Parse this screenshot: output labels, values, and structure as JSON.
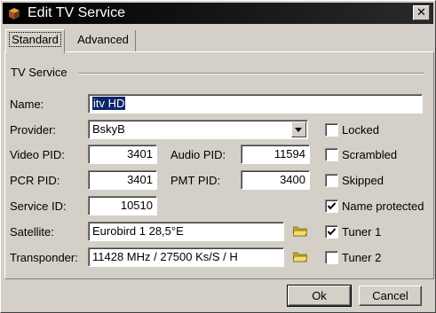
{
  "window": {
    "title": "Edit TV Service",
    "close_glyph": "✕"
  },
  "tabs": [
    {
      "label": "Standard",
      "active": true
    },
    {
      "label": "Advanced",
      "active": false
    }
  ],
  "group": {
    "title": "TV Service"
  },
  "fields": {
    "name": {
      "label": "Name:",
      "value": "itv HD"
    },
    "provider": {
      "label": "Provider:",
      "value": "BskyB"
    },
    "video_pid": {
      "label": "Video PID:",
      "value": "3401"
    },
    "audio_pid": {
      "label": "Audio PID:",
      "value": "11594"
    },
    "pcr_pid": {
      "label": "PCR PID:",
      "value": "3401"
    },
    "pmt_pid": {
      "label": "PMT PID:",
      "value": "3400"
    },
    "service_id": {
      "label": "Service ID:",
      "value": "10510"
    },
    "satellite": {
      "label": "Satellite:",
      "value": "Eurobird 1 28,5°E"
    },
    "transponder": {
      "label": "Transponder:",
      "value": "11428 MHz / 27500 Ks/S / H"
    }
  },
  "checkboxes": {
    "locked": {
      "label": "Locked",
      "checked": false
    },
    "scrambled": {
      "label": "Scrambled",
      "checked": false
    },
    "skipped": {
      "label": "Skipped",
      "checked": false
    },
    "name_protected": {
      "label": "Name protected",
      "checked": true
    },
    "tuner1": {
      "label": "Tuner 1",
      "checked": true
    },
    "tuner2": {
      "label": "Tuner 2",
      "checked": false
    }
  },
  "buttons": {
    "ok": "Ok",
    "cancel": "Cancel"
  },
  "icons": {
    "app": "tv-box-icon",
    "folder": "folder-icon",
    "dropdown": "chevron-down-icon",
    "check": "checkmark-icon"
  },
  "colors": {
    "titlebar": "#000000",
    "face": "#d4d0c8",
    "selection": "#0a246a",
    "folder": "#e8d070"
  }
}
